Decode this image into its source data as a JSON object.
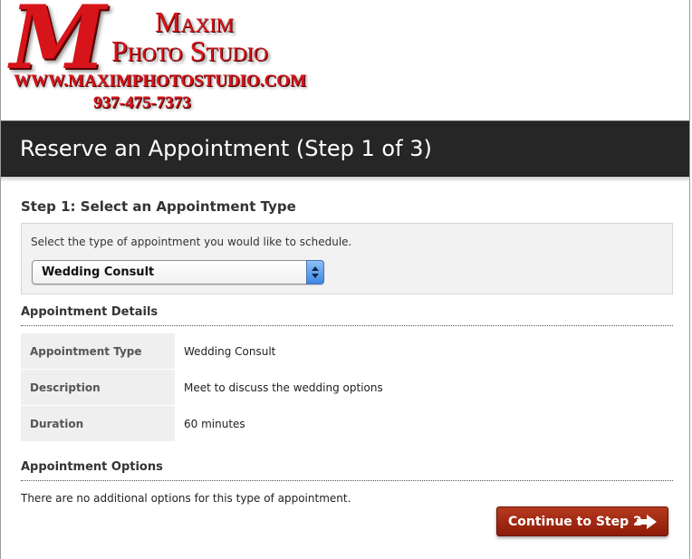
{
  "logo": {
    "initial": "M",
    "line1": "Maxim",
    "line2": "Photo Studio",
    "url": "WWW.MAXIMPHOTOSTUDIO.COM",
    "phone": "937-475-7373"
  },
  "page": {
    "title": "Reserve an Appointment (Step 1 of 3)"
  },
  "step": {
    "heading": "Step 1: Select an Appointment Type",
    "instruction": "Select the type of appointment you would like to schedule.",
    "selected_type": "Wedding Consult"
  },
  "details": {
    "heading": "Appointment Details",
    "rows": [
      {
        "label": "Appointment Type",
        "value": "Wedding Consult"
      },
      {
        "label": "Description",
        "value": "Meet to discuss the wedding options"
      },
      {
        "label": "Duration",
        "value": "60 minutes"
      }
    ]
  },
  "options": {
    "heading": "Appointment Options",
    "text": "There are no additional options for this type of appointment."
  },
  "actions": {
    "continue_label": "Continue to Step 2"
  },
  "colors": {
    "title_band": "#262626",
    "logo_red": "#d7141a",
    "button_red": "#a32b14",
    "select_arrow_blue": "#3d87e3"
  },
  "icons": {
    "continue": "arrow-right-icon",
    "dropdown": "updown-arrows-icon"
  }
}
